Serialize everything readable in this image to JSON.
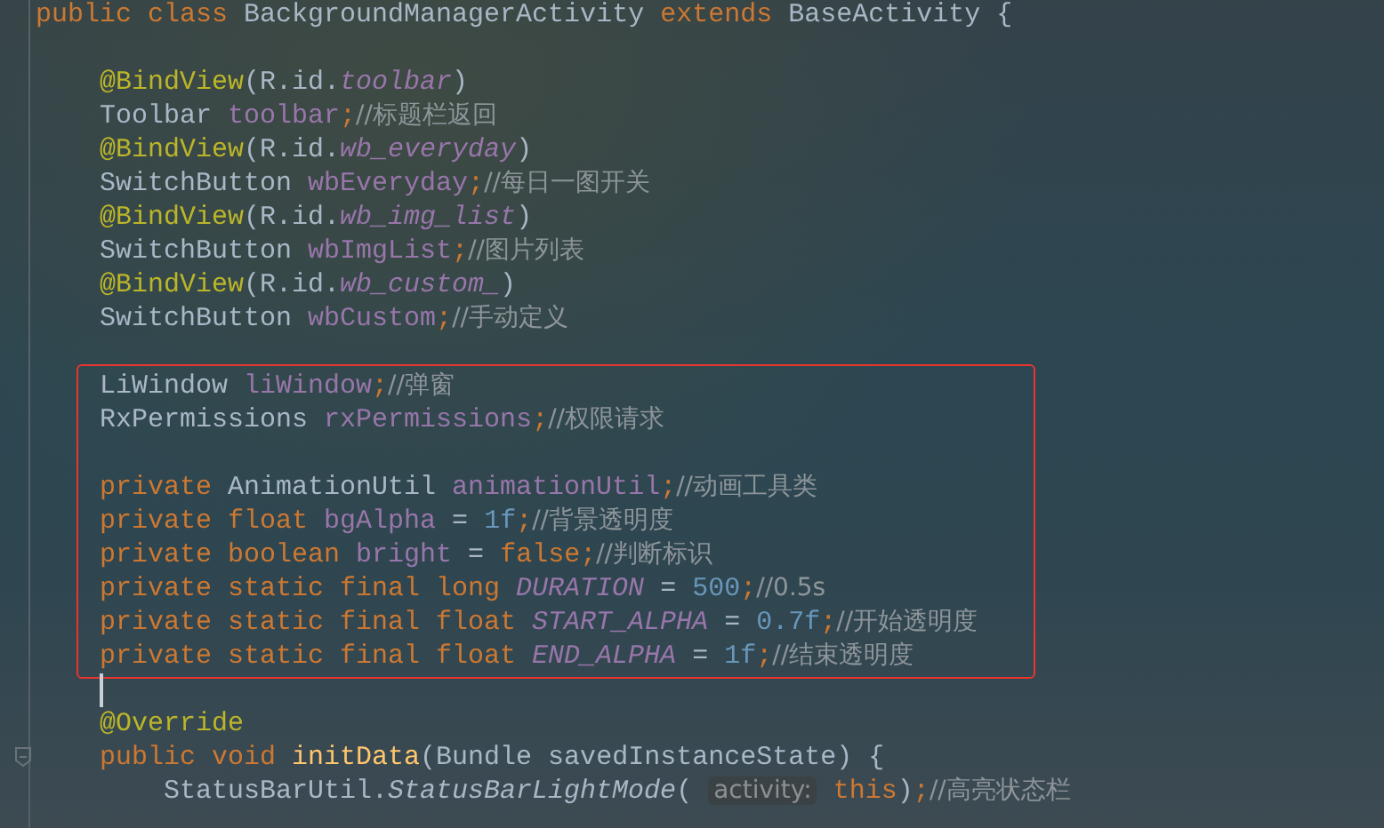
{
  "code": [
    {
      "kind": "code",
      "tokens": [
        {
          "text": "public class ",
          "kind": "keyword"
        },
        {
          "text": "BackgroundManagerActivity ",
          "kind": "plain"
        },
        {
          "text": "extends ",
          "kind": "keyword"
        },
        {
          "text": "BaseActivity {",
          "kind": "plain"
        }
      ],
      "children": [
        {
          "kind": "blank"
        },
        {
          "kind": "code",
          "tokens": [
            {
              "text": "@BindView",
              "kind": "annotation"
            },
            {
              "text": "(R.id.",
              "kind": "plain"
            },
            {
              "text": "toolbar",
              "kind": "constant"
            },
            {
              "text": ")",
              "kind": "plain"
            }
          ]
        },
        {
          "kind": "code",
          "tokens": [
            {
              "text": "Toolbar ",
              "kind": "plain"
            },
            {
              "text": "toolbar",
              "kind": "field"
            },
            {
              "text": ";",
              "kind": "keyword"
            },
            {
              "text": "//标题栏返回",
              "kind": "comment"
            }
          ]
        },
        {
          "kind": "code",
          "tokens": [
            {
              "text": "@BindView",
              "kind": "annotation"
            },
            {
              "text": "(R.id.",
              "kind": "plain"
            },
            {
              "text": "wb_everyday",
              "kind": "constant"
            },
            {
              "text": ")",
              "kind": "plain"
            }
          ]
        },
        {
          "kind": "code",
          "tokens": [
            {
              "text": "SwitchButton ",
              "kind": "plain"
            },
            {
              "text": "wbEveryday",
              "kind": "field"
            },
            {
              "text": ";",
              "kind": "keyword"
            },
            {
              "text": "//每日一图开关",
              "kind": "comment"
            }
          ]
        },
        {
          "kind": "code",
          "tokens": [
            {
              "text": "@BindView",
              "kind": "annotation"
            },
            {
              "text": "(R.id.",
              "kind": "plain"
            },
            {
              "text": "wb_img_list",
              "kind": "constant"
            },
            {
              "text": ")",
              "kind": "plain"
            }
          ]
        },
        {
          "kind": "code",
          "tokens": [
            {
              "text": "SwitchButton ",
              "kind": "plain"
            },
            {
              "text": "wbImgList",
              "kind": "field"
            },
            {
              "text": ";",
              "kind": "keyword"
            },
            {
              "text": "//图片列表",
              "kind": "comment"
            }
          ]
        },
        {
          "kind": "code",
          "tokens": [
            {
              "text": "@BindView",
              "kind": "annotation"
            },
            {
              "text": "(R.id.",
              "kind": "plain"
            },
            {
              "text": "wb_custom_",
              "kind": "constant"
            },
            {
              "text": ")",
              "kind": "plain"
            }
          ]
        },
        {
          "kind": "code",
          "tokens": [
            {
              "text": "SwitchButton ",
              "kind": "plain"
            },
            {
              "text": "wbCustom",
              "kind": "field"
            },
            {
              "text": ";",
              "kind": "keyword"
            },
            {
              "text": "//手动定义",
              "kind": "comment"
            }
          ]
        },
        {
          "kind": "blank"
        },
        {
          "kind": "highlight",
          "children": [
            {
              "kind": "code",
              "tokens": [
                {
                  "text": "LiWindow ",
                  "kind": "plain"
                },
                {
                  "text": "liWindow",
                  "kind": "field"
                },
                {
                  "text": ";",
                  "kind": "keyword"
                },
                {
                  "text": "//弹窗",
                  "kind": "comment"
                }
              ]
            },
            {
              "kind": "code",
              "tokens": [
                {
                  "text": "RxPermissions ",
                  "kind": "plain"
                },
                {
                  "text": "rxPermissions",
                  "kind": "field"
                },
                {
                  "text": ";",
                  "kind": "keyword"
                },
                {
                  "text": "//权限请求",
                  "kind": "comment"
                }
              ]
            },
            {
              "kind": "blank"
            },
            {
              "kind": "code",
              "tokens": [
                {
                  "text": "private ",
                  "kind": "keyword"
                },
                {
                  "text": "AnimationUtil ",
                  "kind": "plain"
                },
                {
                  "text": "animationUtil",
                  "kind": "field"
                },
                {
                  "text": ";",
                  "kind": "keyword"
                },
                {
                  "text": "//动画工具类",
                  "kind": "comment"
                }
              ]
            },
            {
              "kind": "code",
              "tokens": [
                {
                  "text": "private float ",
                  "kind": "keyword"
                },
                {
                  "text": "bgAlpha",
                  "kind": "field"
                },
                {
                  "text": " = ",
                  "kind": "plain"
                },
                {
                  "text": "1f",
                  "kind": "number"
                },
                {
                  "text": ";",
                  "kind": "keyword"
                },
                {
                  "text": "//背景透明度",
                  "kind": "comment"
                }
              ]
            },
            {
              "kind": "code",
              "tokens": [
                {
                  "text": "private boolean ",
                  "kind": "keyword"
                },
                {
                  "text": "bright",
                  "kind": "field"
                },
                {
                  "text": " = ",
                  "kind": "plain"
                },
                {
                  "text": "false;",
                  "kind": "keyword"
                },
                {
                  "text": "//判断标识",
                  "kind": "comment"
                }
              ]
            },
            {
              "kind": "code",
              "tokens": [
                {
                  "text": "private static final long ",
                  "kind": "keyword"
                },
                {
                  "text": "DURATION",
                  "kind": "constant"
                },
                {
                  "text": " = ",
                  "kind": "plain"
                },
                {
                  "text": "500",
                  "kind": "number"
                },
                {
                  "text": ";",
                  "kind": "keyword"
                },
                {
                  "text": "//0.5s",
                  "kind": "comment"
                }
              ]
            },
            {
              "kind": "code",
              "tokens": [
                {
                  "text": "private static final float ",
                  "kind": "keyword"
                },
                {
                  "text": "START_ALPHA",
                  "kind": "constant"
                },
                {
                  "text": " = ",
                  "kind": "plain"
                },
                {
                  "text": "0.7f",
                  "kind": "number"
                },
                {
                  "text": ";",
                  "kind": "keyword"
                },
                {
                  "text": "//开始透明度",
                  "kind": "comment"
                }
              ]
            },
            {
              "kind": "code",
              "tokens": [
                {
                  "text": "private static final float ",
                  "kind": "keyword"
                },
                {
                  "text": "END_ALPHA",
                  "kind": "constant"
                },
                {
                  "text": " = ",
                  "kind": "plain"
                },
                {
                  "text": "1f",
                  "kind": "number"
                },
                {
                  "text": ";",
                  "kind": "keyword"
                },
                {
                  "text": "//结束透明度",
                  "kind": "comment"
                }
              ]
            }
          ]
        },
        {
          "kind": "blank",
          "cursor": true
        },
        {
          "kind": "code",
          "tokens": [
            {
              "text": "@Override",
              "kind": "annotation"
            }
          ]
        },
        {
          "kind": "code",
          "tokens": [
            {
              "text": "public void ",
              "kind": "keyword"
            },
            {
              "text": "initData",
              "kind": "method"
            },
            {
              "text": "(Bundle savedInstanceState) {",
              "kind": "plain"
            }
          ],
          "children": [
            {
              "kind": "code",
              "tokens": [
                {
                  "text": "StatusBarUtil.",
                  "kind": "plain"
                },
                {
                  "text": "StatusBarLightMode",
                  "kind": "static_call"
                },
                {
                  "text": "( ",
                  "kind": "plain"
                },
                {
                  "text": "activity:",
                  "kind": "hint"
                },
                {
                  "text": " this",
                  "kind": "keyword"
                },
                {
                  "text": ")",
                  "kind": "plain"
                },
                {
                  "text": ";",
                  "kind": "keyword"
                },
                {
                  "text": "//高亮状态栏",
                  "kind": "comment"
                }
              ]
            }
          ]
        }
      ]
    }
  ]
}
